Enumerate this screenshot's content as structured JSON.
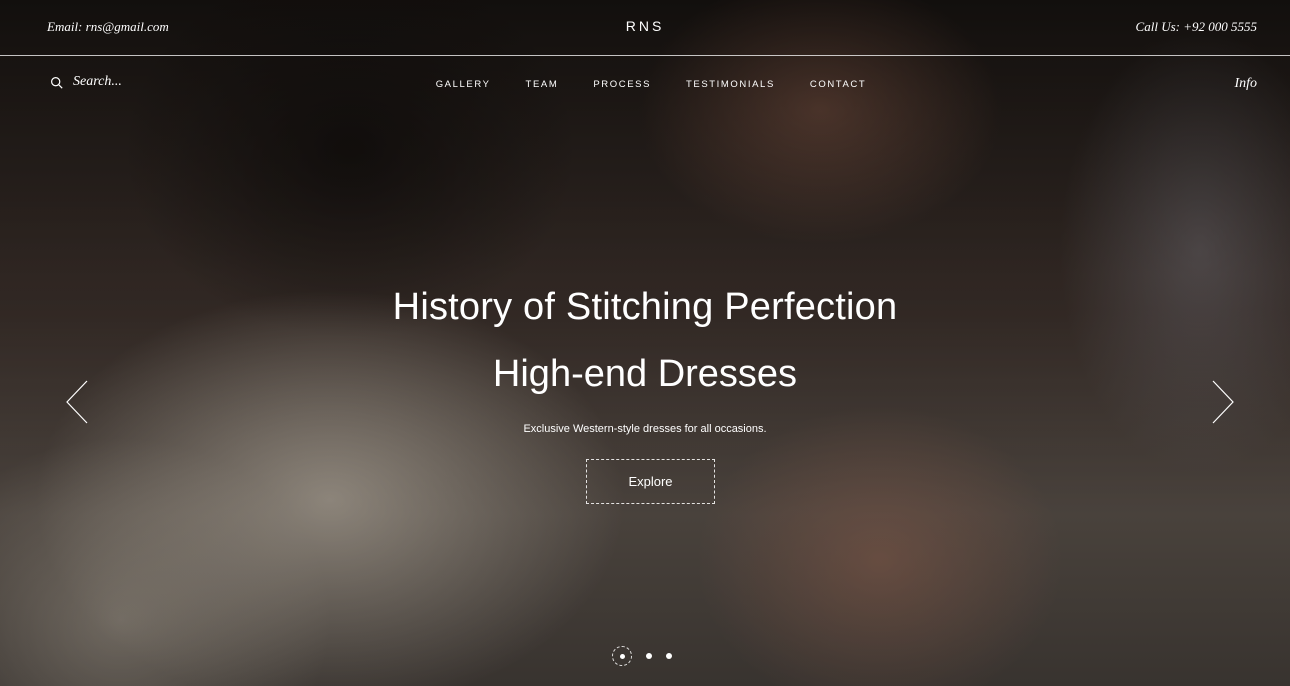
{
  "topbar": {
    "email": "Email: rns@gmail.com",
    "brand": "RNS",
    "phone": "Call Us: +92 000 5555"
  },
  "navbar": {
    "search_placeholder": "Search...",
    "links": [
      "GALLERY",
      "TEAM",
      "PROCESS",
      "TESTIMONIALS",
      "CONTACT"
    ],
    "info": "Info"
  },
  "hero": {
    "title": "History of Stitching Perfection",
    "subtitle": "High-end Dresses",
    "description": "Exclusive Western-style dresses for all occasions.",
    "cta": "Explore",
    "slides_total": 3,
    "active_slide": 1
  },
  "icons": {
    "search": "search-icon",
    "prev": "chevron-left-icon",
    "next": "chevron-right-icon"
  },
  "colors": {
    "text": "#ffffff"
  }
}
